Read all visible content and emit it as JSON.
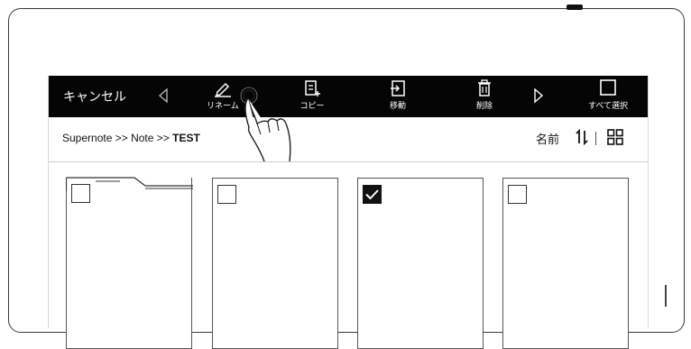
{
  "toolbar": {
    "cancel_label": "キャンセル",
    "rename_label": "リネーム",
    "copy_label": "コピー",
    "move_label": "移動",
    "delete_label": "削除",
    "select_all_label": "すべて選択"
  },
  "path": {
    "root": "Supernote",
    "separator": " >> ",
    "folder": "Note",
    "current": "TEST"
  },
  "sort": {
    "label": "名前"
  },
  "files": [
    {
      "kind": "folder",
      "checked": false
    },
    {
      "kind": "note",
      "checked": false
    },
    {
      "kind": "note",
      "checked": true
    },
    {
      "kind": "note",
      "checked": false
    }
  ],
  "colors": {
    "toolbar_bg": "#050505",
    "toolbar_text": "#ffffff",
    "accent": "#111111"
  }
}
